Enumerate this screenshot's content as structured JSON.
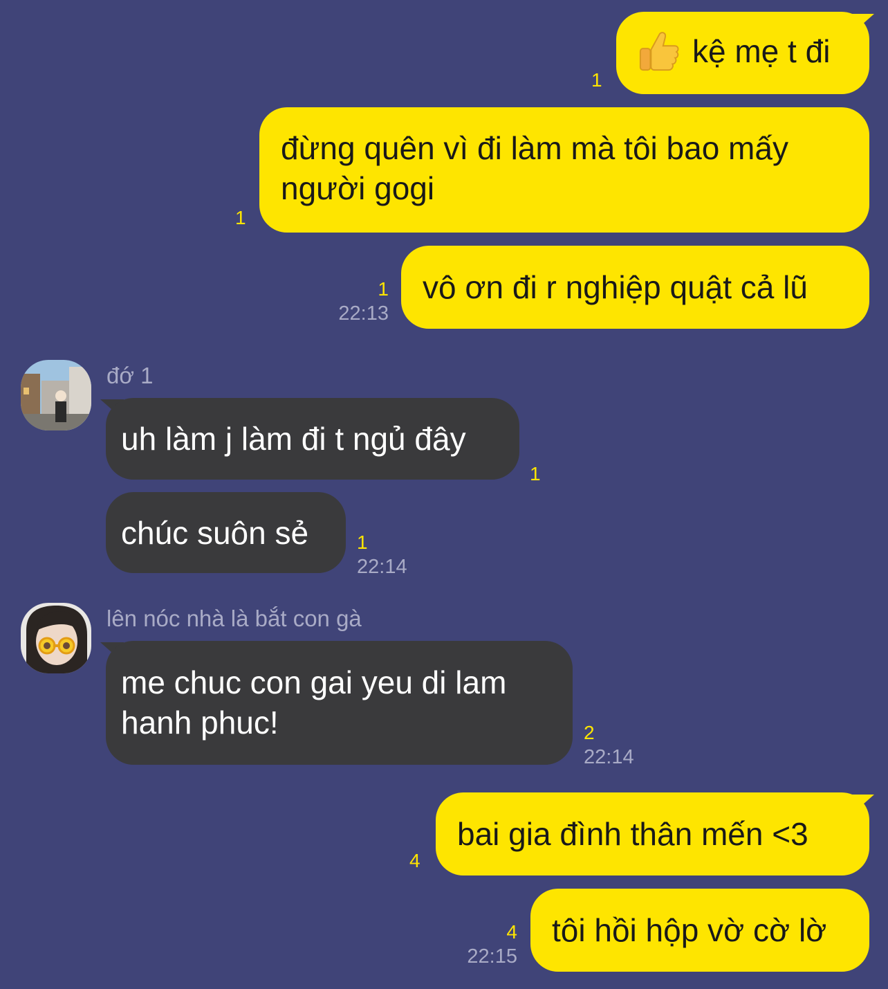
{
  "messages": [
    {
      "text": "kệ mẹ t đi",
      "emoji": "thumbs-up",
      "unread": "1"
    },
    {
      "text": "đừng quên vì đi làm mà tôi bao mấy người gogi",
      "unread": "1"
    },
    {
      "text": "vô ơn đi r nghiệp quật cả lũ",
      "unread": "1",
      "time": "22:13"
    },
    {
      "sender": "đớ 1",
      "text": "uh làm j làm đi t ngủ đây",
      "unread": "1"
    },
    {
      "text": "chúc suôn sẻ",
      "unread": "1",
      "time": "22:14"
    },
    {
      "sender": "lên nóc nhà là bắt con gà",
      "text": "me chuc con gai yeu di lam hanh phuc!",
      "unread": "2",
      "time": "22:14"
    },
    {
      "text": "bai gia đình thân mến <3",
      "unread": "4"
    },
    {
      "text": "tôi hồi hộp vờ cờ lờ",
      "unread": "4",
      "time": "22:15"
    }
  ],
  "colors": {
    "background": "#404478",
    "outgoing_bubble": "#FEE500",
    "incoming_bubble": "#3A3A3C",
    "unread_count": "#FEE500",
    "meta_text": "#A9ABC6"
  }
}
